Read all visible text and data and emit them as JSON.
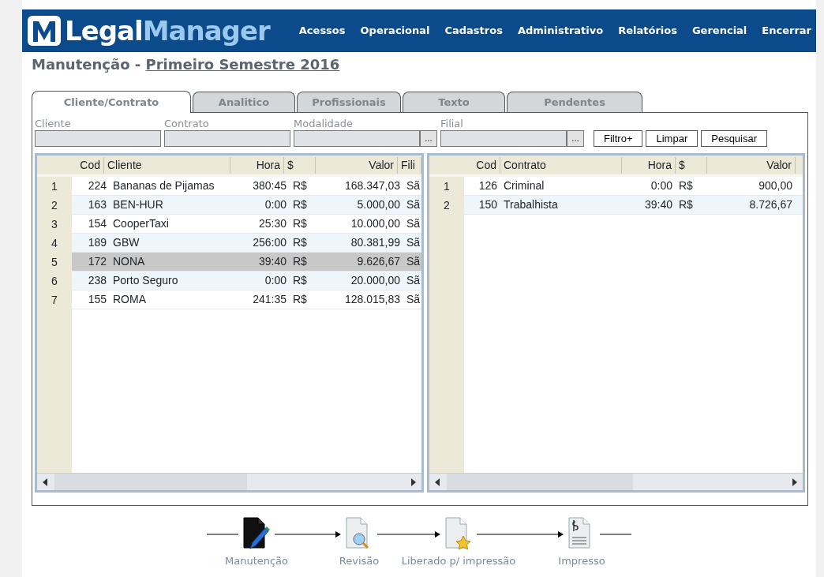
{
  "header": {
    "logo": {
      "first": "Legal",
      "second": "Manager"
    },
    "menu": [
      "Acessos",
      "Operacional",
      "Cadastros",
      "Administrativo",
      "Relatórios",
      "Gerencial",
      "Encerrar"
    ]
  },
  "title": {
    "prefix": "Manutenção - ",
    "link": "Primeiro Semestre 2016"
  },
  "tabs": [
    {
      "label": "Cliente/Contrato",
      "selected": true
    },
    {
      "label": "Analitico",
      "selected": false
    },
    {
      "label": "Profissionais",
      "selected": false
    },
    {
      "label": "Texto",
      "selected": false
    },
    {
      "label": "Pendentes",
      "selected": false
    }
  ],
  "filters": [
    {
      "label": "Cliente",
      "kind": "text"
    },
    {
      "label": "Contrato",
      "kind": "text"
    },
    {
      "label": "Modalidade",
      "kind": "lookup",
      "button": "..."
    },
    {
      "label": "Filial",
      "kind": "lookup",
      "button": "..."
    }
  ],
  "filter_buttons": [
    "Filtro+",
    "Limpar",
    "Pesquisar"
  ],
  "client_table": {
    "columns": [
      "Cod",
      "Cliente",
      "Hora",
      "$",
      "Valor",
      "Fili"
    ],
    "rows": [
      {
        "number": "1",
        "cells": [
          "224",
          "Bananas de Pijamas",
          "380:45",
          "R$",
          "168.347,03",
          "Sã"
        ],
        "selected": false
      },
      {
        "number": "2",
        "cells": [
          "163",
          "BEN-HUR",
          "0:00",
          "R$",
          "5.000,00",
          "Sã"
        ],
        "selected": false
      },
      {
        "number": "3",
        "cells": [
          "154",
          "CooperTaxi",
          "25:30",
          "R$",
          "10.000,00",
          "Sã"
        ],
        "selected": false
      },
      {
        "number": "4",
        "cells": [
          "189",
          "GBW",
          "256:00",
          "R$",
          "80.381,99",
          "Sã"
        ],
        "selected": false
      },
      {
        "number": "5",
        "cells": [
          "172",
          "NONA",
          "39:40",
          "R$",
          "9.626,67",
          "Sã"
        ],
        "selected": true
      },
      {
        "number": "6",
        "cells": [
          "238",
          "Porto Seguro",
          "0:00",
          "R$",
          "20.000,00",
          "Sã"
        ],
        "selected": false
      },
      {
        "number": "7",
        "cells": [
          "155",
          "ROMA",
          "241:35",
          "R$",
          "128.015,83",
          "Sã"
        ],
        "selected": false
      }
    ]
  },
  "contract_table": {
    "columns": [
      "Cod",
      "Contrato",
      "Hora",
      "$",
      "Valor"
    ],
    "rows": [
      {
        "number": "1",
        "cells": [
          "126",
          "Criminal",
          "0:00",
          "R$",
          "900,00"
        ],
        "selected": false
      },
      {
        "number": "2",
        "cells": [
          "150",
          "Trabalhista",
          "39:40",
          "R$",
          "8.726,67"
        ],
        "selected": false
      }
    ]
  },
  "workflow": [
    {
      "label": "Manutenção",
      "kind": "edit",
      "current": true
    },
    {
      "label": "Revisão",
      "kind": "review",
      "current": false
    },
    {
      "label": "Liberado p/ impressão",
      "kind": "approved",
      "current": false
    },
    {
      "label": "Impresso",
      "kind": "printed",
      "current": false
    }
  ]
}
